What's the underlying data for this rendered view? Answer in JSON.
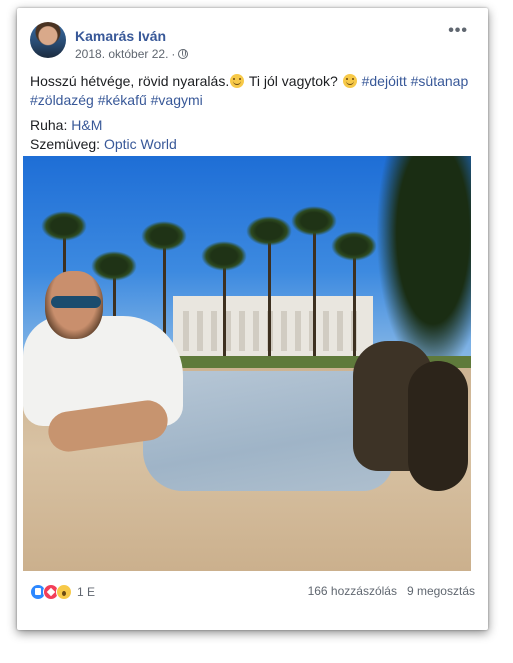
{
  "post": {
    "author": "Kamarás Iván",
    "date": "2018. október 22.",
    "dot": "·",
    "more": "•••",
    "text_line1_a": "Hosszú hétvége, rövid nyaralás.",
    "text_line1_b": " Ti jól vagytok?",
    "hashtags_line1": "#dejóitt #sütanap",
    "hashtags_line2": "#zöldazég #kékafű #vagymi",
    "clothes_label": "Ruha:",
    "clothes_value": "H&M",
    "glasses_label": "Szemüveg:",
    "glasses_value": "Optic World",
    "icons": [
      "globe-icon",
      "more-icon",
      "smile-emoji-icon"
    ]
  },
  "footer": {
    "reaction_count": "1 E",
    "comments": "166 hozzászólás",
    "shares": "9 megosztás",
    "reactions": [
      "like",
      "love",
      "wow"
    ]
  }
}
